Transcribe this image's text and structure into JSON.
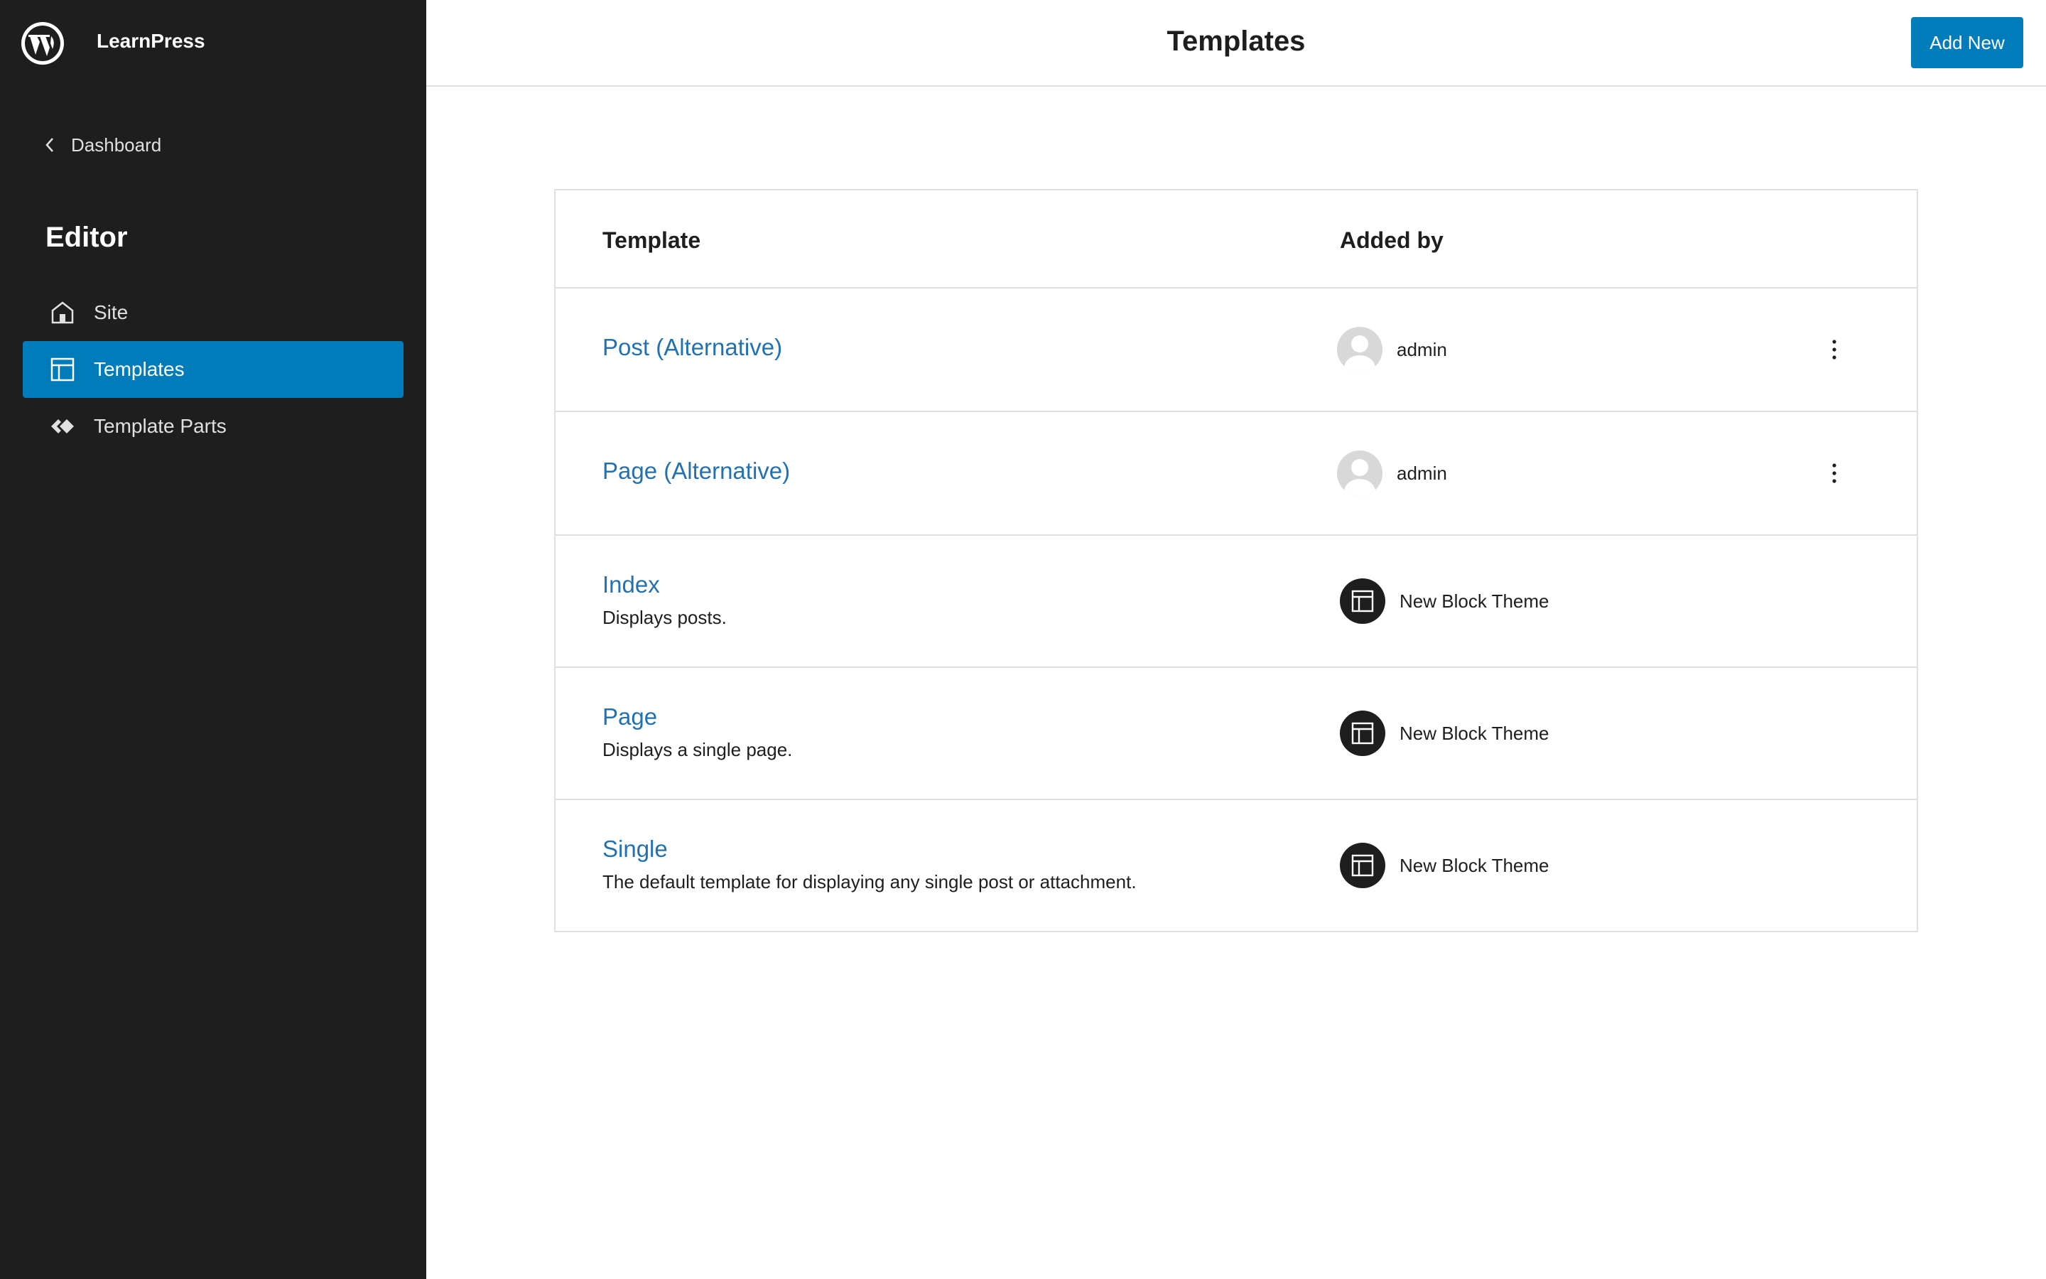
{
  "sidebar": {
    "site_name": "LearnPress",
    "back_label": "Dashboard",
    "section_title": "Editor",
    "items": [
      {
        "label": "Site",
        "icon": "home-icon",
        "active": false
      },
      {
        "label": "Templates",
        "icon": "layout-icon",
        "active": true
      },
      {
        "label": "Template Parts",
        "icon": "template-parts-icon",
        "active": false
      }
    ]
  },
  "header": {
    "title": "Templates",
    "add_new_label": "Add New"
  },
  "table": {
    "columns": [
      "Template",
      "Added by"
    ],
    "rows": [
      {
        "name": "Post (Alternative)",
        "description": "",
        "author": "admin",
        "author_type": "user"
      },
      {
        "name": "Page (Alternative)",
        "description": "",
        "author": "admin",
        "author_type": "user"
      },
      {
        "name": "Index",
        "description": "Displays posts.",
        "author": "New Block Theme",
        "author_type": "theme"
      },
      {
        "name": "Page",
        "description": "Displays a single page.",
        "author": "New Block Theme",
        "author_type": "theme"
      },
      {
        "name": "Single",
        "description": "The default template for displaying any single post or attachment.",
        "author": "New Block Theme",
        "author_type": "theme"
      }
    ]
  },
  "colors": {
    "sidebar_bg": "#1e1e1e",
    "accent": "#007cba",
    "link": "#2271b1"
  }
}
